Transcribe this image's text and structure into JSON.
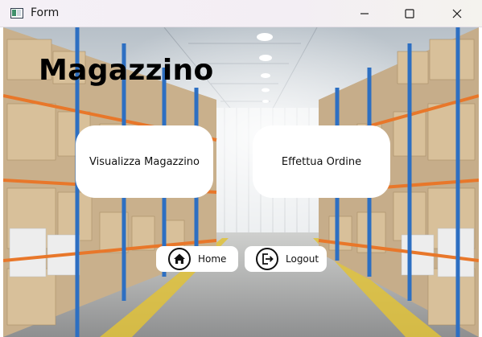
{
  "window": {
    "title": "Form",
    "controls": [
      "minimize",
      "maximize",
      "close"
    ]
  },
  "main": {
    "heading": "Magazzino",
    "background": "warehouse-aisle-photo",
    "buttons": {
      "visualizza": "Visualizza Magazzino",
      "ordine": "Effettua Ordine",
      "home": "Home",
      "logout": "Logout"
    }
  },
  "icons": {
    "home": "home-icon",
    "logout": "logout-icon"
  },
  "colors": {
    "button_bg": "#ffffff",
    "heading": "#000000",
    "rack_blue": "#2d6fc2",
    "rack_orange": "#e8772a",
    "floor_line": "#e0c23a"
  }
}
